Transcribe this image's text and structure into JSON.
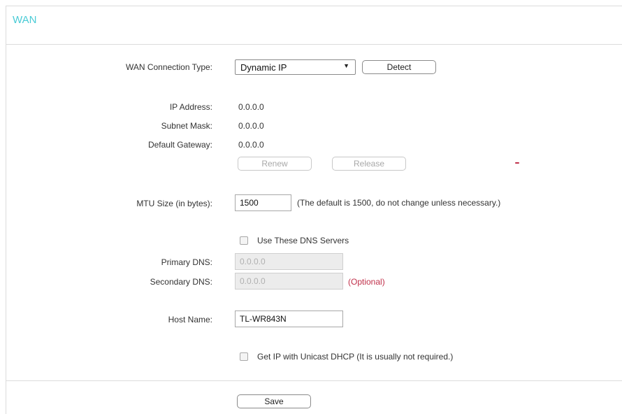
{
  "panel": {
    "title": "WAN"
  },
  "wan": {
    "connection_type_label": "WAN Connection Type:",
    "connection_type_value": "Dynamic IP",
    "detect_label": "Detect",
    "ip_address_label": "IP Address:",
    "ip_address_value": "0.0.0.0",
    "subnet_mask_label": "Subnet Mask:",
    "subnet_mask_value": "0.0.0.0",
    "default_gateway_label": "Default Gateway:",
    "default_gateway_value": "0.0.0.0",
    "renew_label": "Renew",
    "release_label": "Release"
  },
  "mtu": {
    "label": "MTU Size (in bytes):",
    "value": "1500",
    "hint": "(The default is 1500, do not change unless necessary.)"
  },
  "dns": {
    "use_dns_label": "Use These DNS Servers",
    "use_dns_checked": false,
    "primary_label": "Primary DNS:",
    "primary_placeholder": "0.0.0.0",
    "secondary_label": "Secondary DNS:",
    "secondary_placeholder": "0.0.0.0",
    "optional_text": "(Optional)"
  },
  "host": {
    "label": "Host Name:",
    "value": "TL-WR843N"
  },
  "unicast": {
    "label": "Get IP with Unicast DHCP (It is usually not required.)",
    "checked": false
  },
  "actions": {
    "save_label": "Save"
  },
  "colors": {
    "title": "#4acbd6",
    "optional": "#c0304a",
    "border": "#dcdcdc"
  }
}
